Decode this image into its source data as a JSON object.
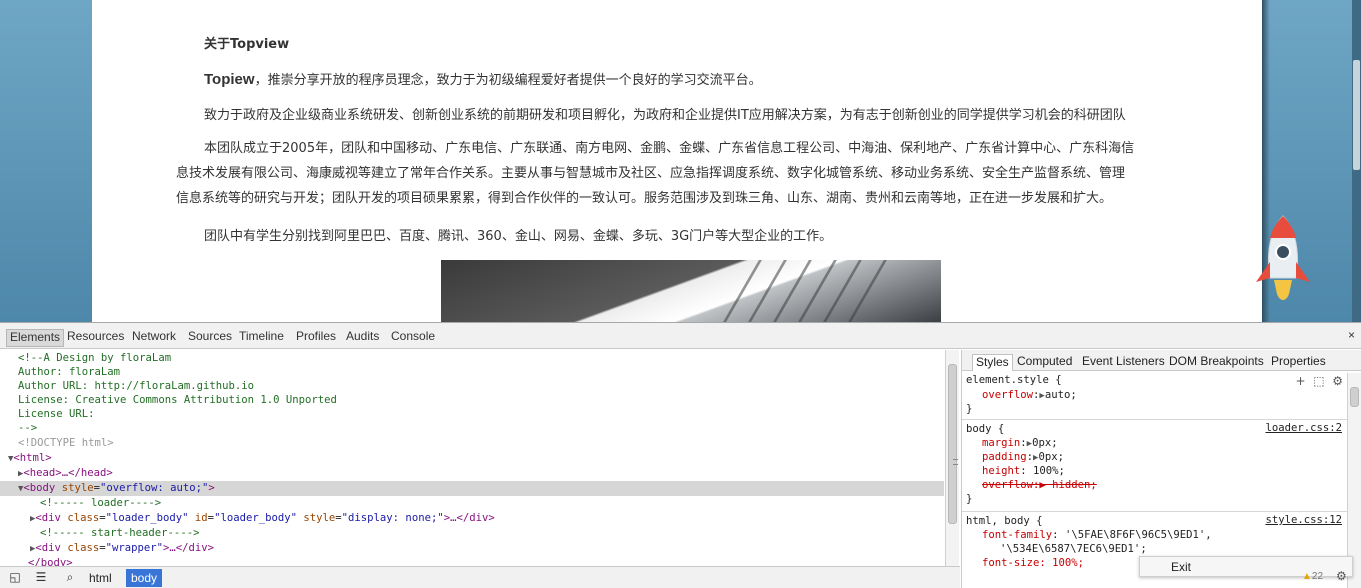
{
  "page": {
    "heading": "关于Topview",
    "p1_brand": "Topiew",
    "p1_text": "，推崇分享开放的程序员理念，致力于为初级编程爱好者提供一个良好的学习交流平台。",
    "p2": "致力于政府及企业级商业系统研发、创新创业系统的前期研发和项目孵化，为政府和企业提供IT应用解决方案，为有志于创新创业的同学提供学习机会的科研团队",
    "p3_line1": "本团队成立于2005年，团队和中国移动、广东电信、广东联通、南方电网、金鹏、金蝶、广东省信息工程公司、中海油、保利地产、广东省计算中心、广东科海信",
    "p3_line2": "息技术发展有限公司、海康威视等建立了常年合作关系。主要从事与智慧城市及社区、应急指挥调度系统、数字化城管系统、移动业务系统、安全生产监督系统、管理",
    "p3_line3": "信息系统等的研究与开发；团队开发的项目硕果累累，得到合作伙伴的一致认可。服务范围涉及到珠三角、山东、湖南、贵州和云南等地，正在进一步发展和扩大。",
    "p4": "团队中有学生分别找到阿里巴巴、百度、腾讯、360、金山、网易、金蝶、多玩、3G门户等大型企业的工作。"
  },
  "devtools": {
    "tabs": [
      "Elements",
      "Resources",
      "Network",
      "Sources",
      "Timeline",
      "Profiles",
      "Audits",
      "Console"
    ],
    "active_tab": "Elements",
    "close": "×",
    "elements": {
      "c1": "<!--A Design by floraLam",
      "c2": "Author: floraLam",
      "c3": "Author URL: http://floraLam.github.io",
      "c4": "License: Creative Commons Attribution 1.0 Unported",
      "c5": "License URL:",
      "c6": "-->",
      "doctype": "<!DOCTYPE html>",
      "html_open": "<html>",
      "head": "<head>…</head>",
      "body_tag": "<body ",
      "body_attr": "style",
      "body_val": "\"overflow: auto;\"",
      "body_close": ">",
      "loader_comment": "<!----- loader---->",
      "div1_open": "<div ",
      "div1_class_attr": "class",
      "div1_class_val": "\"loader_body\"",
      "div1_id_attr": "id",
      "div1_id_val": "\"loader_body\"",
      "div1_style_attr": "style",
      "div1_style_val": "\"display: none;\"",
      "div1_tail": ">…</div>",
      "header_comment": "<!----- start-header---->",
      "div2_open": "<div ",
      "div2_class_attr": "class",
      "div2_class_val": "\"wrapper\"",
      "div2_tail": ">…</div>",
      "body_end": "</body>"
    },
    "styles_tabs": [
      "Styles",
      "Computed",
      "Event Listeners",
      "DOM Breakpoints",
      "Properties"
    ],
    "styles": {
      "r1_selector": "element.style {",
      "r1_p1_name": "overflow",
      "r1_p1_val": "auto;",
      "r2_selector": "body {",
      "r2_source": "loader.css:2",
      "r2_p1_name": "margin",
      "r2_p1_val": "0px;",
      "r2_p2_name": "padding",
      "r2_p2_val": "0px;",
      "r2_p3_name": "height",
      "r2_p3_val": "100%;",
      "r2_p4_strike": "overflow:▶ hidden;",
      "r3_selector": "html, body {",
      "r3_source": "style.css:12",
      "r3_p1_name": "font-family",
      "r3_p1_val": "'\\5FAE\\8F6F\\96C5\\9ED1',",
      "r3_p1_val2": "'\\534E\\6587\\7EC6\\9ED1';",
      "r3_p2": "font-size: 100%;",
      "close": "}"
    },
    "breadcrumbs": [
      "html",
      "body"
    ],
    "active_crumb": "body",
    "exit_label": "Exit",
    "warnings": "22"
  }
}
